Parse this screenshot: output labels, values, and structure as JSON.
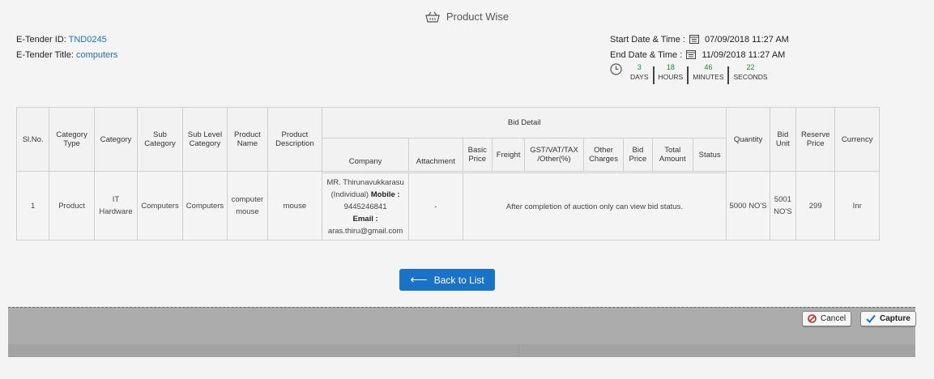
{
  "header": {
    "title": "Product Wise",
    "icon": "basket-icon"
  },
  "tender": {
    "id_label": "E-Tender ID:",
    "id_value": "TND0245",
    "title_label": "E-Tender Title:",
    "title_value": "computers"
  },
  "dates": {
    "start_label": "Start Date & Time :",
    "start_value": "07/09/2018 11:27 AM",
    "end_label": "End Date & Time :",
    "end_value": "11/09/2018 11:27 AM"
  },
  "countdown": {
    "days": "3",
    "days_label": "DAYS",
    "hours": "18",
    "hours_label": "HOURS",
    "minutes": "46",
    "minutes_label": "MINUTES",
    "seconds": "22",
    "seconds_label": "SECONDS"
  },
  "table": {
    "headers": {
      "sl_no": "Sl.No.",
      "category_type": "Category Type",
      "category": "Category",
      "sub_category": "Sub Category",
      "sub_level_category": "Sub Level Category",
      "product_name": "Product Name",
      "product_description": "Product Description",
      "bid_detail": "Bid Detail",
      "quantity": "Quantity",
      "bid_unit": "Bid Unit",
      "reserve_price": "Reserve Price",
      "currency": "Currency"
    },
    "bid_headers": {
      "company": "Company",
      "attachment": "Attachment",
      "basic_price": "Basic Price",
      "freight": "Freight",
      "gst": "GST/VAT/TAX /Other(%)",
      "other_charges": "Other Charges",
      "bid_price": "Bid Price",
      "total_amount": "Total Amount",
      "status": "Status"
    },
    "row": {
      "sl_no": "1",
      "category_type": "Product",
      "category": "IT Hardware",
      "sub_category": "Computers",
      "sub_level_category": "Computers",
      "product_name": "computer mouse",
      "product_description": "mouse",
      "company_name": "MR. Thirunavukkarasu (Individual)",
      "mobile_label": "Mobile :",
      "mobile_value": "9445246841",
      "email_label": "Email :",
      "email_value": "aras.thiru@gmail.com",
      "attachment": "-",
      "bid_note": "After completion of auction only can view bid status.",
      "quantity": "5000 NO'S",
      "bid_unit": "5001 NO'S",
      "reserve_price": "299",
      "currency": "Inr"
    }
  },
  "actions": {
    "back_label": "Back to List"
  },
  "capture": {
    "cancel_label": "Cancel",
    "capture_label": "Capture"
  },
  "colors": {
    "link": "#1f6fb8",
    "primary_button": "#1a73c6",
    "countdown_number": "#1a8a3a"
  }
}
